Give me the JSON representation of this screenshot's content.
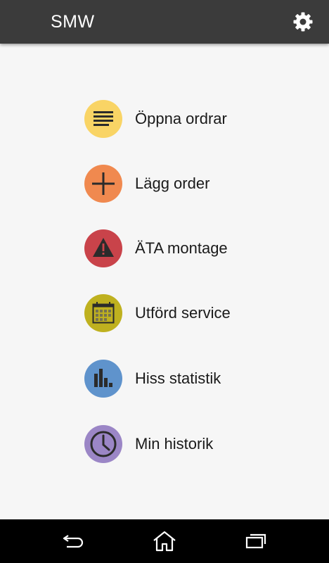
{
  "app_bar": {
    "title": "SMW",
    "settings_icon": "gear-icon"
  },
  "menu": {
    "items": [
      {
        "label": "Öppna ordrar",
        "icon": "list-icon",
        "color": "#f9d465"
      },
      {
        "label": "Lägg order",
        "icon": "plus-icon",
        "color": "#f0894f"
      },
      {
        "label": "ÄTA montage",
        "icon": "warning-icon",
        "color": "#c9434a"
      },
      {
        "label": "Utförd service",
        "icon": "calendar-icon",
        "color": "#bfb11f"
      },
      {
        "label": "Hiss statistik",
        "icon": "bar-chart-icon",
        "color": "#5f93cc"
      },
      {
        "label": "Min historik",
        "icon": "clock-icon",
        "color": "#9b86c6"
      }
    ]
  },
  "nav_bar": {
    "back_icon": "back-icon",
    "home_icon": "home-icon",
    "recents_icon": "recents-icon"
  },
  "colors": {
    "app_bar": "#3b3b3b",
    "background": "#f6f6f6",
    "nav_bar": "#000000"
  }
}
